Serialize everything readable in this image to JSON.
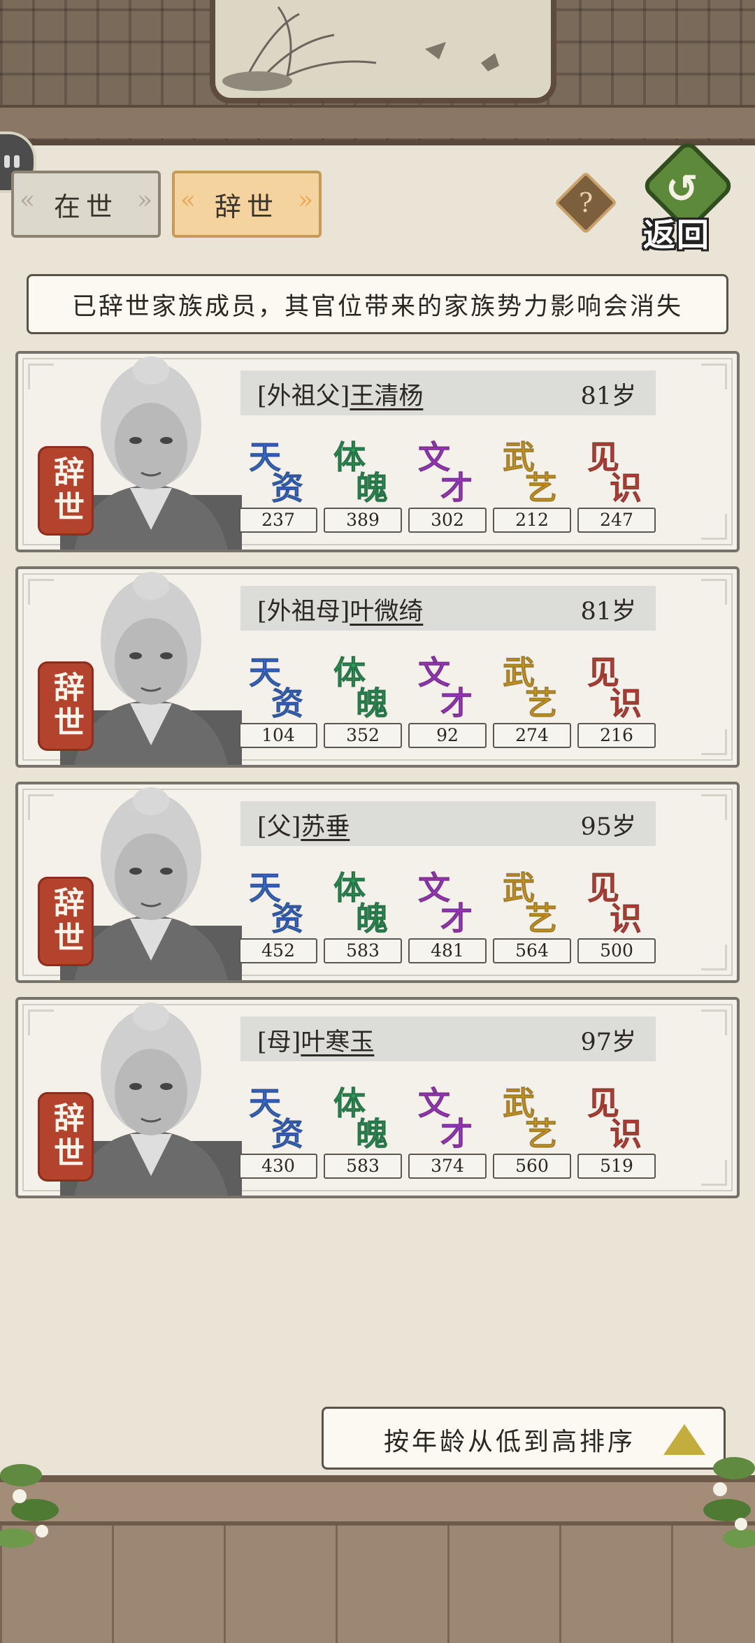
{
  "tabs": {
    "alive": "在世",
    "deceased": "辞世"
  },
  "help": {
    "label": "?"
  },
  "back": {
    "label": "返回",
    "arrow": "↺"
  },
  "notice": "已辞世家族成员，其官位带来的家族势力影响会消失",
  "seal_text": "辞世",
  "stat_labels": [
    {
      "a": "天",
      "b": "资",
      "color": "#3a6fd0"
    },
    {
      "a": "体",
      "b": "魄",
      "color": "#2c9a5a"
    },
    {
      "a": "文",
      "b": "才",
      "color": "#a63bc7"
    },
    {
      "a": "武",
      "b": "艺",
      "color": "#d9a427"
    },
    {
      "a": "见",
      "b": "识",
      "color": "#c8453a"
    }
  ],
  "members": [
    {
      "relation": "[外祖父]",
      "name": "王清杨",
      "age": "81岁",
      "stats": [
        "237",
        "389",
        "302",
        "212",
        "247"
      ]
    },
    {
      "relation": "[外祖母]",
      "name": "叶微绮",
      "age": "81岁",
      "stats": [
        "104",
        "352",
        "92",
        "274",
        "216"
      ]
    },
    {
      "relation": "[父]",
      "name": "苏垂",
      "age": "95岁",
      "stats": [
        "452",
        "583",
        "481",
        "564",
        "500"
      ]
    },
    {
      "relation": "[母]",
      "name": "叶寒玉",
      "age": "97岁",
      "stats": [
        "430",
        "583",
        "374",
        "560",
        "519"
      ]
    }
  ],
  "sort": {
    "label": "按年龄从低到高排序"
  }
}
